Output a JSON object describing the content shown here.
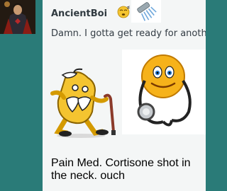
{
  "post": {
    "username": "AncientBoi",
    "message": "Damn. I gotta get ready for another",
    "caption": "Pain Med. Cortisone shot in the neck. ouch"
  },
  "icons": {
    "avatar": "superhero-avatar",
    "smiley": "sleepy-smiley-icon",
    "shower": "shower-icon",
    "sick_emoji": "sick-old-smiley-with-cane",
    "doctor_emoji": "smiley-with-stethoscope"
  },
  "colors": {
    "background": "#2a7b78",
    "post_background": "#f4f6f6",
    "username": "#303a40",
    "message": "#333c44",
    "smiley_yellow": "#f4c430"
  }
}
